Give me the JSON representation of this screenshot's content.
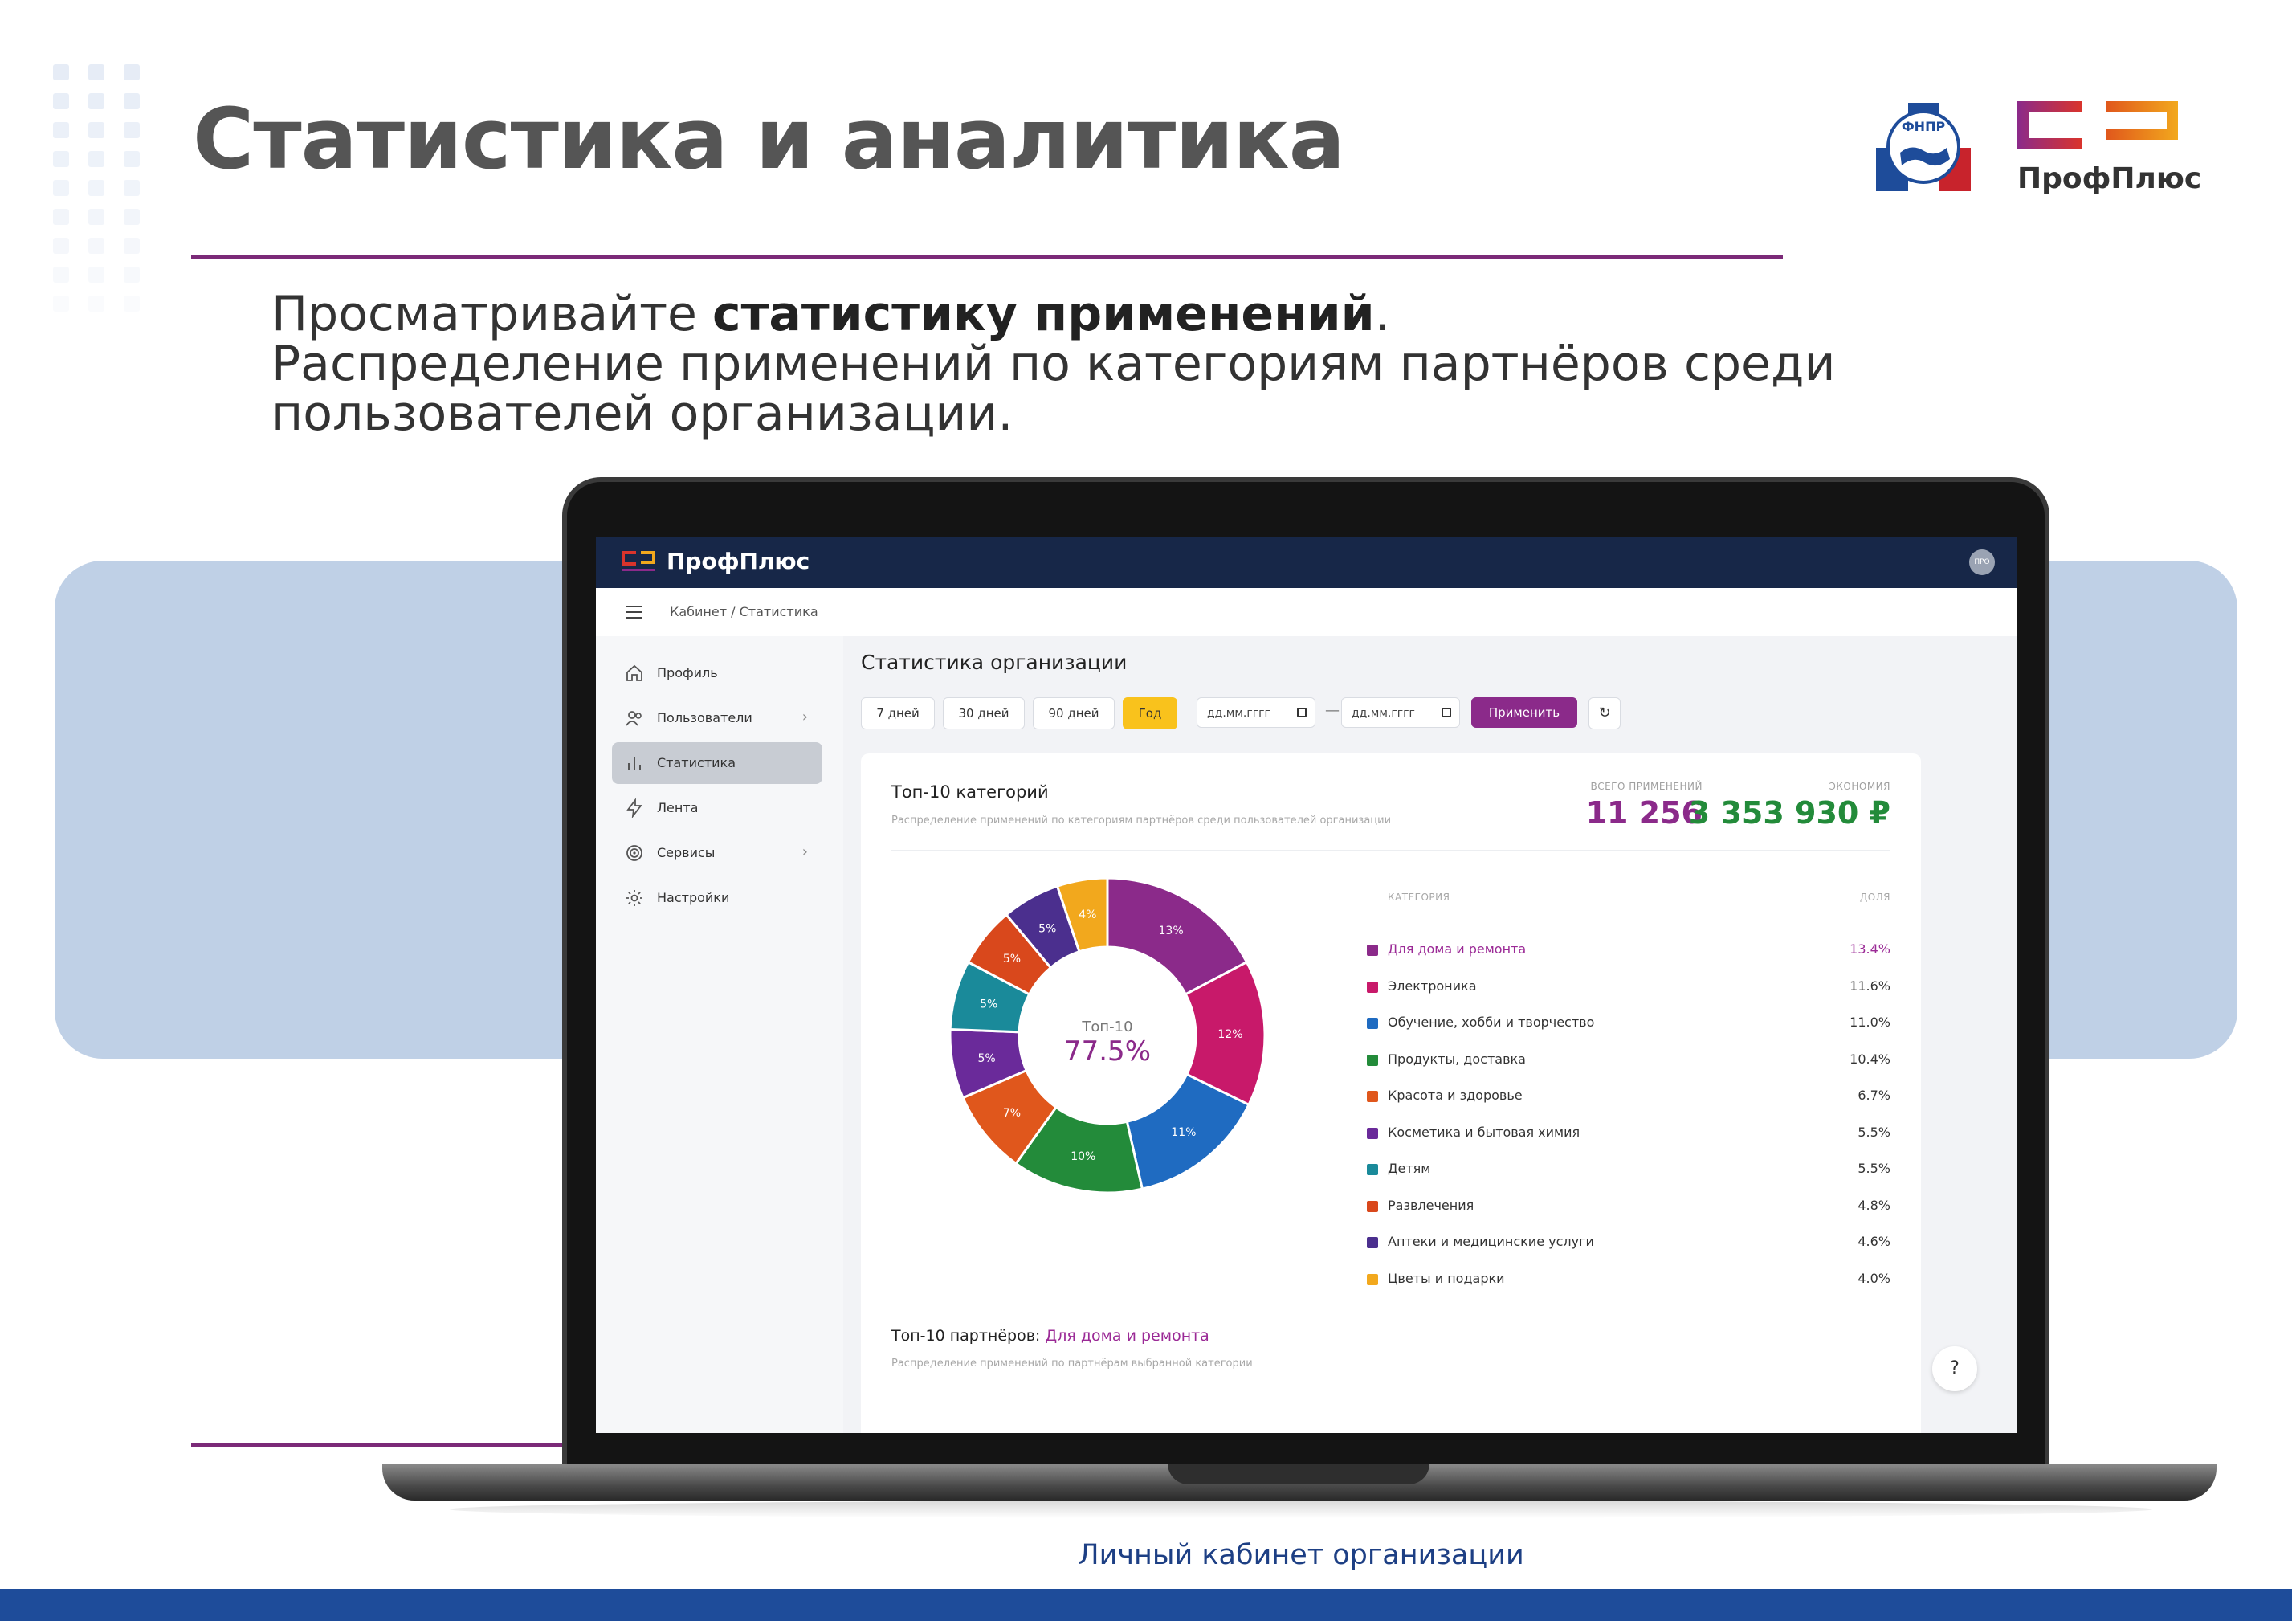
{
  "slide": {
    "title": "Статистика и аналитика",
    "subtitle_pre": "Просматривайте ",
    "subtitle_bold": "статистику применений",
    "subtitle_post": ".",
    "subtitle_line2": "Распределение применений по категориям партнёров среди",
    "subtitle_line3": "пользователей организации.",
    "caption": "Личный кабинет организации",
    "logo_name": "ПрофПлюс",
    "fnpr_text": "ФНПР"
  },
  "app": {
    "brand": "ПрофПлюс",
    "avatar": "ПРО",
    "breadcrumb": "Кабинет / Статистика"
  },
  "sidebar": {
    "items": [
      {
        "label": "Профиль",
        "icon": "home-icon",
        "active": false,
        "chevron": false
      },
      {
        "label": "Пользователи",
        "icon": "users-icon",
        "active": false,
        "chevron": true
      },
      {
        "label": "Статистика",
        "icon": "bar-chart-icon",
        "active": true,
        "chevron": false
      },
      {
        "label": "Лента",
        "icon": "lightning-icon",
        "active": false,
        "chevron": false
      },
      {
        "label": "Сервисы",
        "icon": "target-icon",
        "active": false,
        "chevron": true
      },
      {
        "label": "Настройки",
        "icon": "gear-icon",
        "active": false,
        "chevron": false
      }
    ]
  },
  "main": {
    "title": "Статистика организации",
    "filters": [
      "7 дней",
      "30 дней",
      "90 дней",
      "Год"
    ],
    "active_filter": "Год",
    "date_from_placeholder": "дд.мм.гггг",
    "date_to_placeholder": "дд.мм.гггг",
    "apply_label": "Применить",
    "refresh_icon": "↻"
  },
  "card": {
    "title": "Топ-10 категорий",
    "subtitle": "Распределение применений по категориям партнёров среди пользователей организации",
    "kpi_total_label": "ВСЕГО ПРИМЕНЕНИЙ",
    "kpi_total_value": "11 256",
    "kpi_saving_label": "ЭКОНОМИЯ",
    "kpi_saving_value": "3 353 930 ₽",
    "donut_center_label": "Топ-10",
    "donut_center_value": "77.5%",
    "legend_head_category": "КАТЕГОРИЯ",
    "legend_head_share": "ДОЛЯ",
    "partners_title": "Топ-10 партнёров: ",
    "partners_category": "Для дома и ремонта",
    "partners_subtitle": "Распределение применений по партнёрам выбранной категории",
    "help_label": "?"
  },
  "chart_data": {
    "type": "pie",
    "categories": [
      "Для дома и ремонта",
      "Электроника",
      "Обучение, хобби и творчество",
      "Продукты, доставка",
      "Красота и здоровье",
      "Косметика и бытовая химия",
      "Детям",
      "Развлечения",
      "Аптеки и медицинские услуги",
      "Цветы и подарки"
    ],
    "values": [
      13.4,
      11.6,
      11.0,
      10.4,
      6.7,
      5.5,
      5.5,
      4.8,
      4.6,
      4.0
    ],
    "value_labels": [
      "13.4%",
      "11.6%",
      "11.0%",
      "10.4%",
      "6.7%",
      "5.5%",
      "5.5%",
      "4.8%",
      "4.6%",
      "4.0%"
    ],
    "slice_labels": [
      "13%",
      "12%",
      "11%",
      "10%",
      "7%",
      "5%",
      "5%",
      "5%",
      "5%",
      "4%"
    ],
    "colors": [
      "#8b2a8a",
      "#c8196a",
      "#1f6bc1",
      "#238b3a",
      "#e0571c",
      "#6a2a9a",
      "#1a8a9a",
      "#d9481c",
      "#4b2f8e",
      "#f2a81d"
    ],
    "highlighted": "Для дома и ремонта",
    "donut": true
  }
}
